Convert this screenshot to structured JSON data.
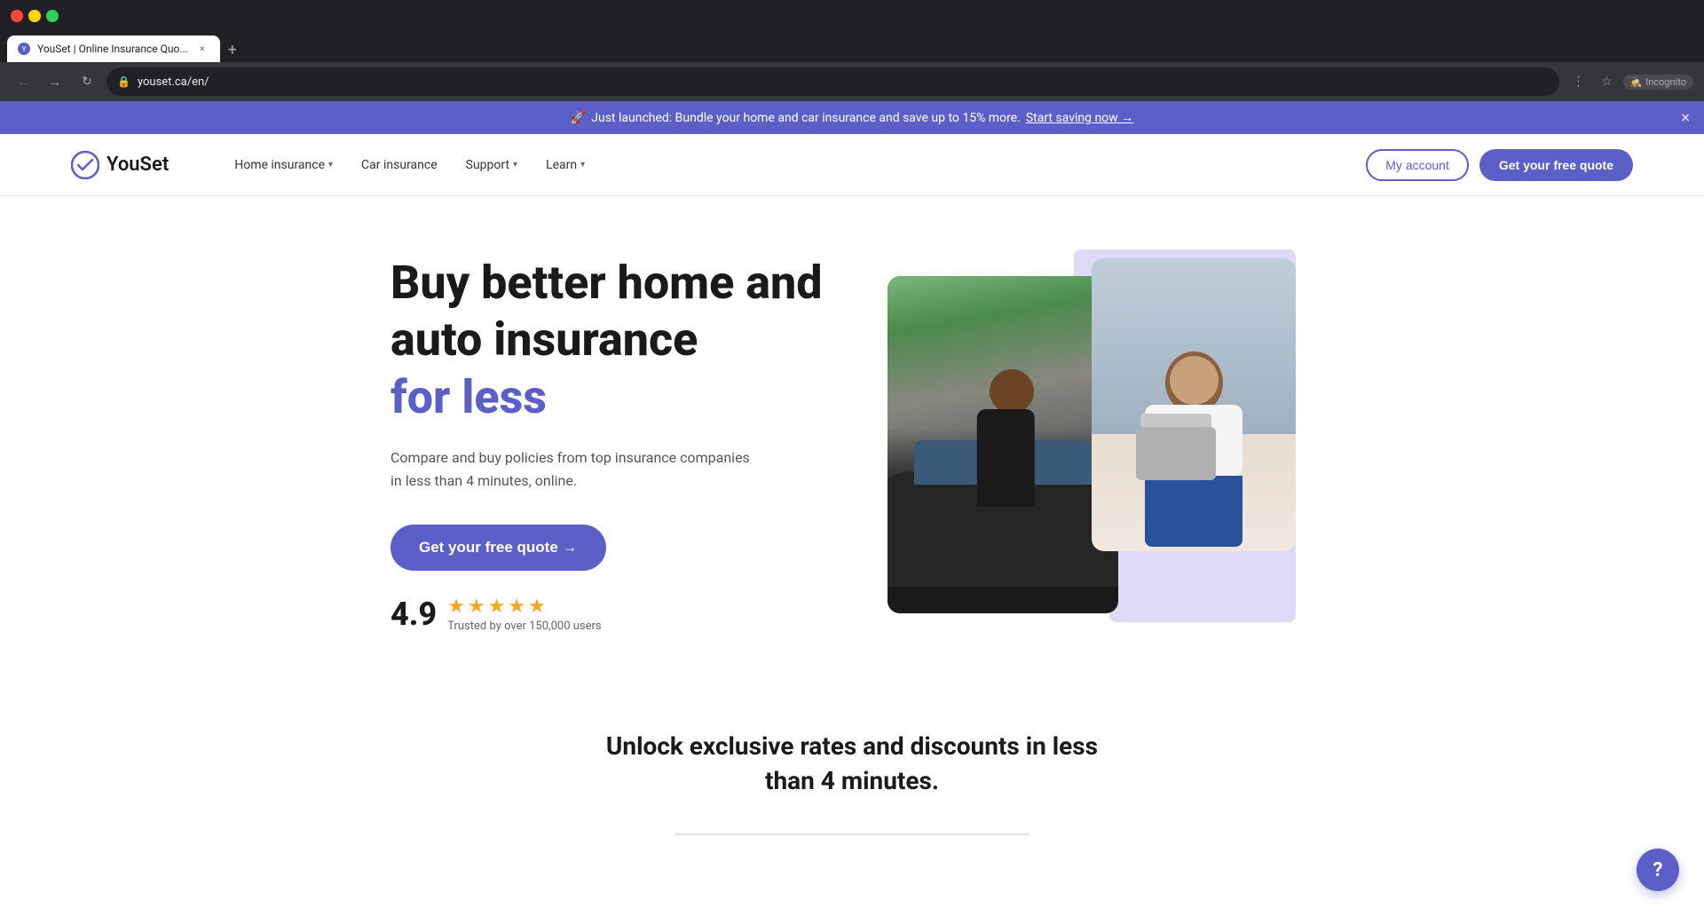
{
  "browser": {
    "tab_title": "YouSet | Online Insurance Quo...",
    "url": "youset.ca/en/",
    "new_tab_label": "+",
    "back_tooltip": "Back",
    "forward_tooltip": "Forward",
    "refresh_tooltip": "Refresh",
    "incognito_label": "Incognito"
  },
  "announcement": {
    "rocket_emoji": "🚀",
    "text": "Just launched: Bundle your home and car insurance and save up to 15% more.",
    "cta_text": "Start saving now →",
    "close_label": "×"
  },
  "navbar": {
    "logo_text": "YouSet",
    "nav_items": [
      {
        "label": "Home insurance",
        "has_dropdown": true
      },
      {
        "label": "Car insurance",
        "has_dropdown": false
      },
      {
        "label": "Support",
        "has_dropdown": true
      },
      {
        "label": "Learn",
        "has_dropdown": true
      }
    ],
    "my_account_label": "My account",
    "get_quote_label": "Get your free quote"
  },
  "hero": {
    "title_line1": "Buy better home and",
    "title_line2": "auto insurance",
    "title_accent": "for less",
    "description": "Compare and buy policies from top insurance companies in less than 4 minutes, online.",
    "cta_label": "Get your free quote →",
    "rating_number": "4.9",
    "stars": [
      "★",
      "★",
      "★",
      "★",
      "★"
    ],
    "rating_label": "Trusted by over 150,000 users"
  },
  "unlock_section": {
    "title": "Unlock exclusive rates and discounts in less than 4 minutes."
  },
  "help_btn": {
    "label": "?"
  }
}
